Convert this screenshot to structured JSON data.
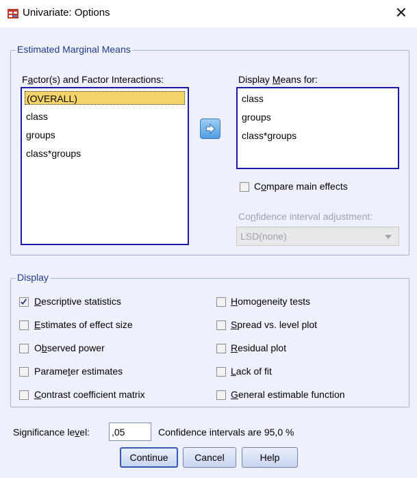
{
  "window": {
    "title": "Univariate: Options",
    "close_glyph": "✕"
  },
  "emm": {
    "legend": "Estimated Marginal Means",
    "factors_label_pre": "F",
    "factors_label_ul": "a",
    "factors_label_post": "ctor(s) and Factor Interactions:",
    "factors": [
      "(OVERALL)",
      "class",
      "groups",
      "class*groups"
    ],
    "display_label_pre": "Display ",
    "display_label_ul": "M",
    "display_label_post": "eans for:",
    "display_means": [
      "class",
      "groups",
      "class*groups"
    ],
    "compare_pre": "C",
    "compare_ul": "o",
    "compare_post": "mpare main effects",
    "ci_adj_pre": "Co",
    "ci_adj_ul": "n",
    "ci_adj_post": "fidence interval adjustment:",
    "ci_adj_value": "LSD(none)"
  },
  "display": {
    "legend": "Display",
    "left": [
      {
        "pre": "",
        "ul": "D",
        "post": "escriptive statistics",
        "checked": true
      },
      {
        "pre": "",
        "ul": "E",
        "post": "stimates of effect size",
        "checked": false
      },
      {
        "pre": "O",
        "ul": "b",
        "post": "served power",
        "checked": false
      },
      {
        "pre": "Parame",
        "ul": "t",
        "post": "er estimates",
        "checked": false
      },
      {
        "pre": "",
        "ul": "C",
        "post": "ontrast coefficient matrix",
        "checked": false
      }
    ],
    "right": [
      {
        "pre": "",
        "ul": "H",
        "post": "omogeneity tests",
        "checked": false
      },
      {
        "pre": "",
        "ul": "S",
        "post": "pread vs. level plot",
        "checked": false
      },
      {
        "pre": "",
        "ul": "R",
        "post": "esidual plot",
        "checked": false
      },
      {
        "pre": "",
        "ul": "L",
        "post": "ack of fit",
        "checked": false
      },
      {
        "pre": "",
        "ul": "G",
        "post": "eneral estimable function",
        "checked": false
      }
    ]
  },
  "significance": {
    "label_pre": "Significance le",
    "label_ul": "v",
    "label_post": "el:",
    "value": ",05",
    "ci_text": "Confidence intervals are 95,0 %"
  },
  "buttons": {
    "continue": "Continue",
    "cancel": "Cancel",
    "help": "Help"
  },
  "icons": {
    "app": "spss-table-icon",
    "arrow": "move-right-arrow-icon",
    "dropdown": "dropdown-arrow-icon"
  }
}
